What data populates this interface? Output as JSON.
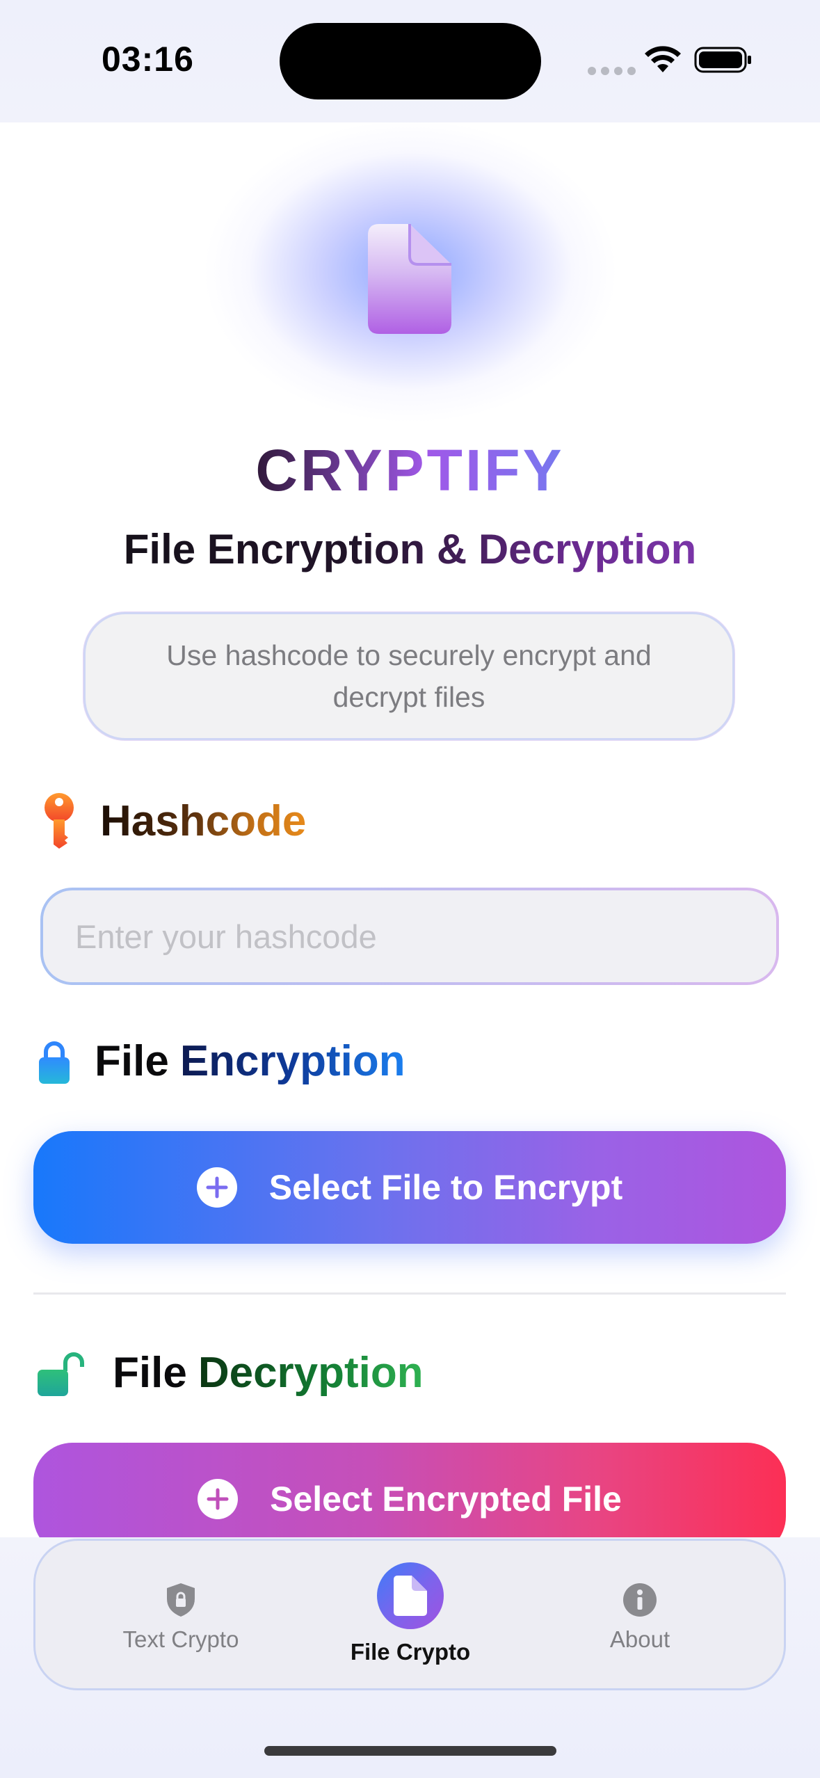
{
  "status_bar": {
    "time": "03:16"
  },
  "header": {
    "app_title": "CRYPTIFY",
    "subtitle": "File Encryption & Decryption",
    "description": "Use hashcode to securely encrypt and decrypt files",
    "icon": "document-icon"
  },
  "hashcode": {
    "heading": "Hashcode",
    "icon": "key-icon",
    "placeholder": "Enter your hashcode",
    "value": ""
  },
  "encryption": {
    "heading_a": "File",
    "heading_b": "Encryption",
    "icon": "lock-closed-icon",
    "button_label": "Select File to Encrypt"
  },
  "decryption": {
    "heading_a": "File",
    "heading_b": "Decryption",
    "icon": "lock-open-icon",
    "button_label": "Select Encrypted File"
  },
  "tab_bar": {
    "tabs": [
      {
        "label": "Text Crypto",
        "icon": "shield-icon",
        "active": false
      },
      {
        "label": "File Crypto",
        "icon": "document-icon",
        "active": true
      },
      {
        "label": "About",
        "icon": "info-icon",
        "active": false
      }
    ]
  },
  "colors": {
    "accent_blue": "#1878fb",
    "accent_purple": "#ae55de",
    "accent_red": "#fc2f55",
    "key_orange": "#e78a1b",
    "encryption_blue": "#1b7ff0",
    "decryption_green": "#2fb252"
  }
}
